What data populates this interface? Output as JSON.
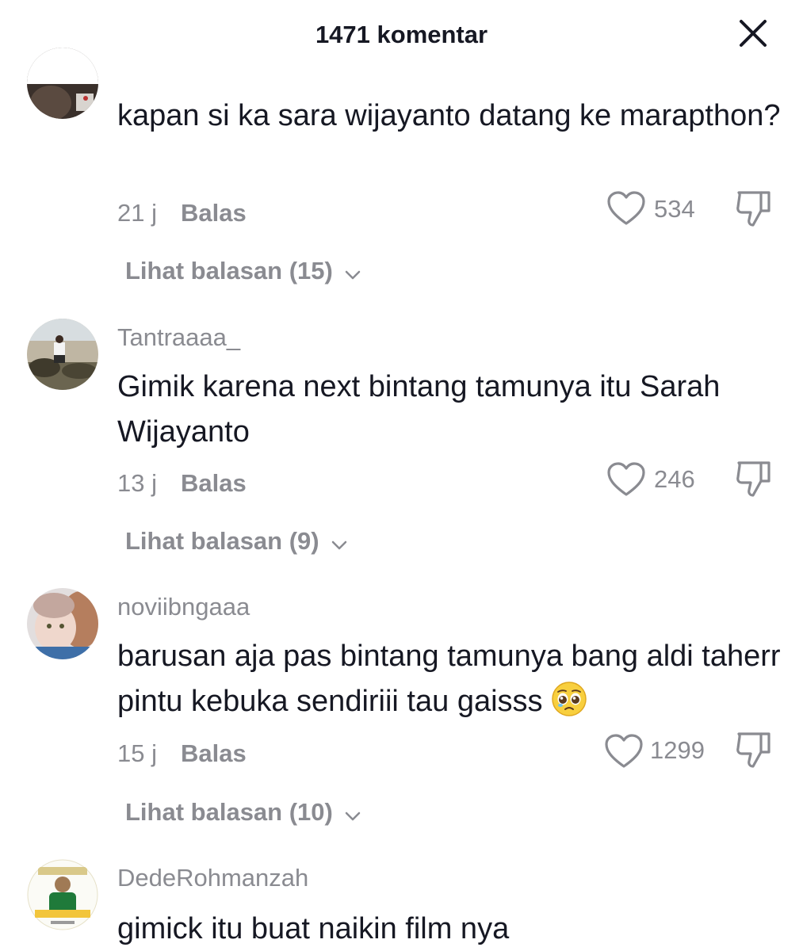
{
  "header": {
    "title": "1471 komentar",
    "close_icon": "close-icon"
  },
  "comments": [
    {
      "username": "",
      "text": "kapan si ka sara wijayanto datang ke marapthon?",
      "time": "21 j",
      "reply_label": "Balas",
      "likes": "534",
      "view_replies": "Lihat balasan (15)"
    },
    {
      "username": "Tantraaaa_",
      "text": "Gimik karena next bintang tamunya itu Sarah Wijayanto",
      "time": "13 j",
      "reply_label": "Balas",
      "likes": "246",
      "view_replies": "Lihat balasan (9)"
    },
    {
      "username": "noviibngaaa",
      "text": "barusan aja pas bintang tamunya bang aldi taherr pintu kebuka sendiriii tau gaisss",
      "emoji": "pleading-face-emoji",
      "time": "15 j",
      "reply_label": "Balas",
      "likes": "1299",
      "view_replies": "Lihat balasan (10)"
    },
    {
      "username": "DedeRohmanzah",
      "text": "gimick itu buat naikin film nya"
    }
  ],
  "icons": {
    "like": "heart-outline-icon",
    "dislike": "thumbs-down-icon",
    "chevron": "chevron-down-icon"
  },
  "colors": {
    "primary_text": "#161823",
    "secondary_text": "#8a8b91",
    "background": "#ffffff"
  }
}
